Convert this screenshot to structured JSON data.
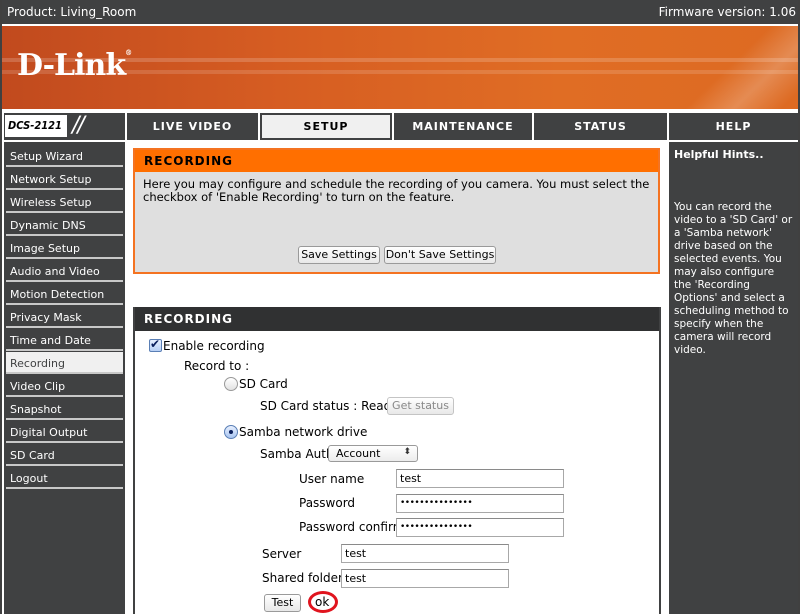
{
  "topbar": {
    "product": "Product: Living_Room",
    "firmware": "Firmware version: 1.06"
  },
  "brand": {
    "logo": "D-Link",
    "registered": "®",
    "model": "DCS-2121",
    "slashes": "//"
  },
  "nav": {
    "tabs": [
      {
        "label": "LIVE VIDEO",
        "active": false
      },
      {
        "label": "SETUP",
        "active": true
      },
      {
        "label": "MAINTENANCE",
        "active": false
      },
      {
        "label": "STATUS",
        "active": false
      },
      {
        "label": "HELP",
        "active": false
      }
    ]
  },
  "sidebar": {
    "items": [
      {
        "label": "Setup Wizard"
      },
      {
        "label": "Network Setup"
      },
      {
        "label": "Wireless Setup"
      },
      {
        "label": "Dynamic DNS"
      },
      {
        "label": "Image Setup"
      },
      {
        "label": "Audio and Video"
      },
      {
        "label": "Motion Detection"
      },
      {
        "label": "Privacy Mask"
      },
      {
        "label": "Time and Date"
      },
      {
        "label": "Recording",
        "active": true
      },
      {
        "label": "Video Clip"
      },
      {
        "label": "Snapshot"
      },
      {
        "label": "Digital Output"
      },
      {
        "label": "SD Card"
      },
      {
        "label": "Logout"
      }
    ]
  },
  "intro": {
    "title": "RECORDING",
    "description": "Here you may configure and schedule the recording of you camera. You must select the checkbox of 'Enable Recording' to turn on the feature.",
    "save_label": "Save Settings",
    "dont_save_label": "Don't Save Settings"
  },
  "recording": {
    "title": "RECORDING",
    "enable_label": "Enable recording",
    "enable_checked": true,
    "record_to_label": "Record to :",
    "sd_card_label": "SD Card",
    "sd_selected": false,
    "sd_status_label": "SD Card status : Ready",
    "get_status_label": "Get status",
    "samba_label": "Samba network drive",
    "samba_selected": true,
    "samba_auth_label": "Samba Auth",
    "samba_auth_value": "Account",
    "username_label": "User name",
    "username_value": "test",
    "password_label": "Password",
    "password_value": "•••••••••••••••",
    "password_confirm_label": "Password confirm",
    "password_confirm_value": "•••••••••••••••",
    "server_label": "Server",
    "server_value": "test",
    "shared_folder_label": "Shared folder",
    "shared_folder_value": "test",
    "test_label": "Test",
    "test_result": "ok",
    "annotation_color": "#e0141e"
  },
  "help": {
    "title": "Helpful Hints..",
    "body": "You can record the video to a 'SD Card' or a 'Samba network' drive based on the selected events. You may also configure the 'Recording Options' and select a scheduling method to specify when the camera will record video."
  },
  "colors": {
    "accent": "#ff6f00",
    "dark": "#404142",
    "header_dark": "#303132"
  }
}
